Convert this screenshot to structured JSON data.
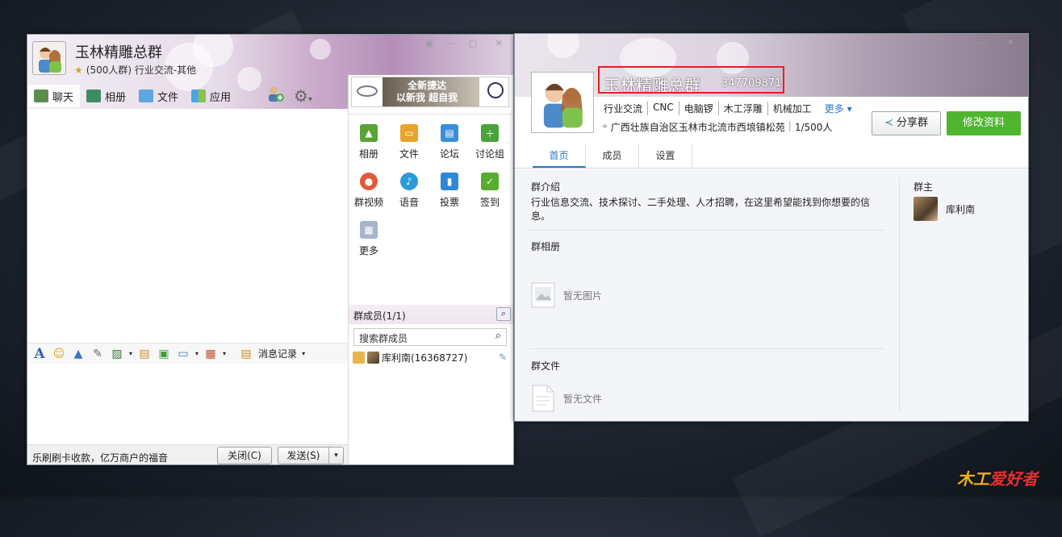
{
  "chat_window": {
    "title": "玉林精雕总群",
    "subtitle": "(500人群) 行业交流-其他",
    "tabs": [
      {
        "label": "聊天"
      },
      {
        "label": "相册"
      },
      {
        "label": "文件"
      },
      {
        "label": "应用"
      }
    ],
    "ad": {
      "line1": "全新捷达",
      "line2": "以新我 超自我"
    },
    "apps": [
      {
        "label": "相册",
        "color": "#58a236"
      },
      {
        "label": "文件",
        "color": "#e8a42a"
      },
      {
        "label": "论坛",
        "color": "#3a8ed8"
      },
      {
        "label": "讨论组",
        "color": "#4aa33a"
      },
      {
        "label": "群视频",
        "color": "#e05a3a"
      },
      {
        "label": "语音",
        "color": "#2b9ad9"
      },
      {
        "label": "投票",
        "color": "#2c88d6"
      },
      {
        "label": "签到",
        "color": "#56ad2e"
      },
      {
        "label": "更多",
        "color": "#a6b4cc"
      }
    ],
    "members": {
      "header": "群成员(1/1)",
      "search_placeholder": "搜索群成员",
      "list": [
        {
          "name": "库利南(16368727)"
        }
      ]
    },
    "toolbar": {
      "history_label": "消息记录"
    },
    "footer": {
      "slogan": "乐刷刷卡收款，亿万商户的福音",
      "close_label": "关闭(C)",
      "send_label": "发送(S)"
    }
  },
  "profile_window": {
    "group_name": "玉林精雕总群",
    "group_number": "347709871",
    "tags": [
      "行业交流",
      "CNC",
      "电脑锣",
      "木工浮雕",
      "机械加工"
    ],
    "more_label": "更多",
    "location": "广西壮族自治区玉林市北流市西埌镇松苑",
    "member_count": "1/500人",
    "share_label": "分享群",
    "edit_label": "修改资料",
    "tabs": [
      "首页",
      "成员",
      "设置"
    ],
    "intro_heading": "群介绍",
    "intro_text": "行业信息交流、技术探讨、二手处理、人才招聘，在这里希望能找到你想要的信息。",
    "album_heading": "群相册",
    "album_empty": "暂无图片",
    "files_heading": "群文件",
    "files_empty": "暂无文件",
    "owner_heading": "群主",
    "owner_name": "库利南"
  },
  "watermark": {
    "part1": "木工",
    "part2": "爱好者"
  }
}
